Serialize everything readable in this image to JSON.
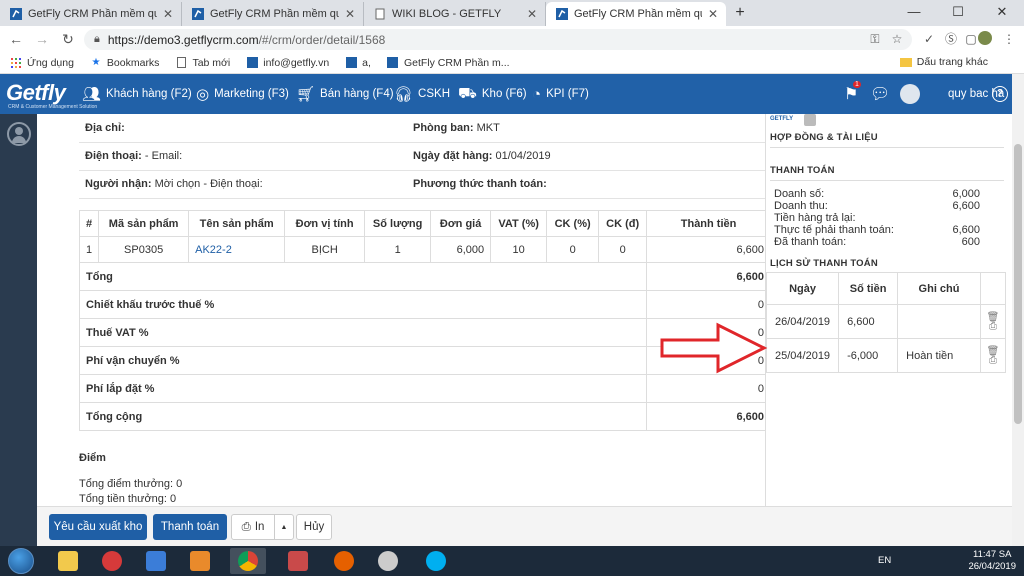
{
  "browser": {
    "tabs": [
      {
        "title": "GetFly CRM Phần mềm quản lý v",
        "active": false
      },
      {
        "title": "GetFly CRM Phần mềm quản lý v",
        "active": false
      },
      {
        "title": "WIKI BLOG - GETFLY",
        "active": false
      },
      {
        "title": "GetFly CRM Phần mềm quản lý v",
        "active": true
      }
    ],
    "new_tab_label": "+",
    "window_controls": {
      "minimize": "—",
      "maximize": "☐",
      "close": "✕"
    },
    "url_host": "https://demo3.getflycrm.com",
    "url_path": "/#/crm/order/detail/1568",
    "bookmarks": [
      {
        "label": "Ứng dụng",
        "icon": "apps-grid-icon"
      },
      {
        "label": "Bookmarks",
        "icon": "star-icon"
      },
      {
        "label": "Tab mới",
        "icon": "page-icon"
      },
      {
        "label": "info@getfly.vn",
        "icon": "mail-icon"
      },
      {
        "label": "a,",
        "icon": "getfly-icon"
      },
      {
        "label": "GetFly CRM Phần m...",
        "icon": "getfly-icon"
      }
    ],
    "other_bookmarks": "Dấu trang khác"
  },
  "app": {
    "logo": "Getfly",
    "logo_sub": "CRM & Customer Management Solution",
    "menu": [
      {
        "label": "Khách hàng (F2)",
        "icon": "users-icon"
      },
      {
        "label": "Marketing (F3)",
        "icon": "target-icon"
      },
      {
        "label": "Bán hàng (F4)",
        "icon": "cart-icon"
      },
      {
        "label": "CSKH",
        "icon": "headset-icon"
      },
      {
        "label": "Kho (F6)",
        "icon": "forklift-icon"
      },
      {
        "label": "KPI (F7)",
        "icon": "gauge-icon"
      }
    ],
    "notification_count": "1",
    "user_name": "quy bac ha",
    "help": "?"
  },
  "order_info": {
    "rows": [
      [
        {
          "label": "Địa chỉ:",
          "value": ""
        },
        {
          "label": "Phòng ban:",
          "value": "MKT"
        }
      ],
      [
        {
          "label": "Điện thoại:",
          "value": "- Email:"
        },
        {
          "label": "Ngày đặt hàng:",
          "value": "01/04/2019"
        }
      ],
      [
        {
          "label": "Người nhận:",
          "value": "Mời chọn - Điện thoại:"
        },
        {
          "label": "Phương thức thanh toán:",
          "value": ""
        }
      ]
    ]
  },
  "products": {
    "headers": [
      "#",
      "Mã sản phẩm",
      "Tên sản phẩm",
      "Đơn vị tính",
      "Số lượng",
      "Đơn giá",
      "VAT (%)",
      "CK (%)",
      "CK (đ)",
      "Thành tiền"
    ],
    "rows": [
      [
        "1",
        "SP0305",
        "AK22-2",
        "BỊCH",
        "1",
        "6,000",
        "10",
        "0",
        "0",
        "6,600"
      ]
    ],
    "totals": [
      {
        "label": "Tổng",
        "value": "6,600",
        "bold": true
      },
      {
        "label": "Chiết khấu trước thuế %",
        "value": "0",
        "bold": false
      },
      {
        "label": "Thuế VAT %",
        "value": "0",
        "bold": false
      },
      {
        "label": "Phí vận chuyển %",
        "value": "0",
        "bold": false
      },
      {
        "label": "Phí lắp đặt %",
        "value": "0",
        "bold": false
      },
      {
        "label": "Tổng cộng",
        "value": "6,600",
        "bold": true
      }
    ]
  },
  "points": {
    "title": "Điểm",
    "lines": [
      "Tổng điểm thưởng: 0",
      "Tổng tiền thưởng: 0"
    ]
  },
  "right_panel": {
    "avatar_label": "GETFLY",
    "contracts_title": "HỢP ĐỒNG & TÀI LIỆU",
    "payment_title": "THANH TOÁN",
    "payment_rows": [
      {
        "label": "Doanh số:",
        "value": "6,000"
      },
      {
        "label": "Doanh thu:",
        "value": "6,600"
      },
      {
        "label": "Tiền hàng trả lại:",
        "value": ""
      },
      {
        "label": "Thực tế phải thanh toán:",
        "value": "6,600"
      },
      {
        "label": "Đã thanh toán:",
        "value": "600"
      }
    ],
    "history_title": "LỊCH SỬ THANH TOÁN",
    "history_headers": [
      "Ngày",
      "Số tiền",
      "Ghi chú"
    ],
    "history_rows": [
      {
        "date": "26/04/2019",
        "amount": "6,600",
        "note": ""
      },
      {
        "date": "25/04/2019",
        "amount": "-6,000",
        "note": "Hoàn tiền"
      }
    ]
  },
  "actions": {
    "export": "Yêu cầu xuất kho",
    "pay": "Thanh toán",
    "print": "In",
    "cancel": "Hủy"
  },
  "taskbar": {
    "lang": "EN",
    "time": "11:47 SA",
    "date": "26/04/2019"
  },
  "colors": {
    "header_blue": "#2161a8",
    "sidebar": "#2a3b4f",
    "primary_button": "#1f5fa6",
    "arrow_red": "#e0262a"
  }
}
